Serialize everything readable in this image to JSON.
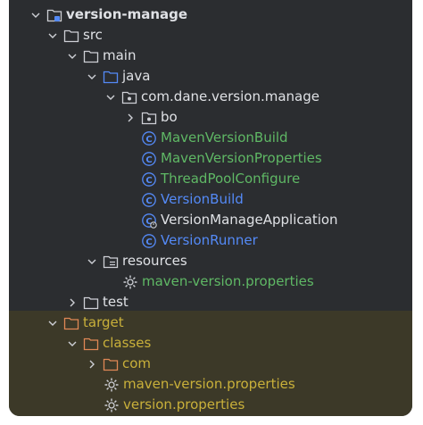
{
  "colors": {
    "panel_bg": "#2b2d30",
    "excluded_band_bg": "#3c3928",
    "default_text": "#dfe1e5",
    "class_text": "#548af7",
    "modified_text": "#5fb865",
    "excluded_text": "#c9b03a",
    "folder_icon": "#ced0d6",
    "source_folder_icon": "#548af7",
    "excluded_folder_icon": "#e08855",
    "class_icon": "#548af7"
  },
  "tree": {
    "version_manage": {
      "label": "version-manage",
      "icon": "module-folder-icon",
      "expanded": true
    },
    "src": {
      "label": "src",
      "icon": "folder-icon",
      "expanded": true
    },
    "main": {
      "label": "main",
      "icon": "folder-icon",
      "expanded": true
    },
    "java": {
      "label": "java",
      "icon": "source-folder-icon",
      "expanded": true
    },
    "package": {
      "label": "com.dane.version.manage",
      "icon": "package-icon",
      "expanded": true
    },
    "bo": {
      "label": "bo",
      "icon": "package-icon",
      "expanded": false
    },
    "maven_version_build": {
      "label": "MavenVersionBuild",
      "icon": "class-icon",
      "status": "modified"
    },
    "maven_version_properties": {
      "label": "MavenVersionProperties",
      "icon": "class-icon",
      "status": "modified"
    },
    "thread_pool_configure": {
      "label": "ThreadPoolConfigure",
      "icon": "class-icon",
      "status": "modified"
    },
    "version_build": {
      "label": "VersionBuild",
      "icon": "class-icon",
      "status": "unversioned"
    },
    "version_manage_application": {
      "label": "VersionManageApplication",
      "icon": "spring-boot-class-icon",
      "status": "unchanged"
    },
    "version_runner": {
      "label": "VersionRunner",
      "icon": "class-icon",
      "status": "unversioned"
    },
    "resources": {
      "label": "resources",
      "icon": "resources-folder-icon",
      "expanded": true
    },
    "maven_version_properties_file": {
      "label": "maven-version.properties",
      "icon": "settings-file-icon",
      "status": "modified"
    },
    "test": {
      "label": "test",
      "icon": "folder-icon",
      "expanded": false
    },
    "target": {
      "label": "target",
      "icon": "excluded-folder-icon",
      "expanded": true,
      "status": "excluded"
    },
    "classes": {
      "label": "classes",
      "icon": "excluded-folder-icon",
      "expanded": true,
      "status": "excluded"
    },
    "com": {
      "label": "com",
      "icon": "excluded-folder-icon",
      "expanded": false,
      "status": "excluded"
    },
    "target_maven_version_properties": {
      "label": "maven-version.properties",
      "icon": "settings-file-icon",
      "status": "excluded"
    },
    "target_version_properties": {
      "label": "version.properties",
      "icon": "settings-file-icon",
      "status": "excluded"
    }
  }
}
